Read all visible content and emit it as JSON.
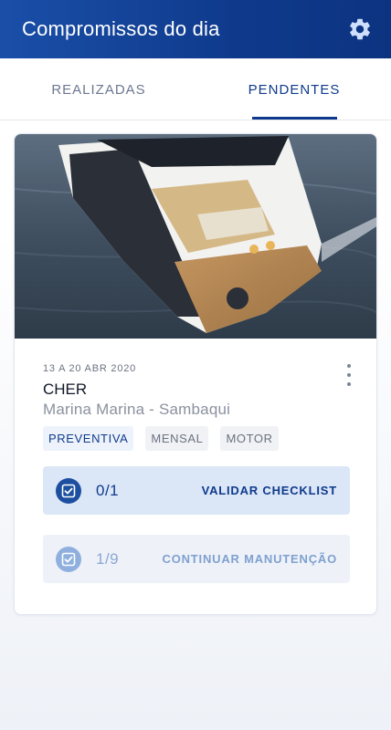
{
  "app_bar": {
    "title": "Compromissos do dia",
    "settings_icon": "gear-icon"
  },
  "tabs": [
    {
      "label": "REALIZADAS",
      "active": false
    },
    {
      "label": "PENDENTES",
      "active": true
    }
  ],
  "card": {
    "image": "boat-photo",
    "date_range": "13 A 20 ABR 2020",
    "boat_name": "CHER",
    "location": "Marina Marina - Sambaqui",
    "tags": [
      "PREVENTIVA",
      "MENSAL",
      "MOTOR"
    ],
    "actions": [
      {
        "count": "0/1",
        "label": "VALIDAR CHECKLIST",
        "icon": "checkbox-icon"
      },
      {
        "count": "1/9",
        "label": "CONTINUAR MANUTENÇÃO",
        "icon": "checkbox-icon"
      }
    ]
  },
  "colors": {
    "primary": "#0f3a8c",
    "accent_light": "#dbe6f7",
    "muted": "#8a919d"
  }
}
